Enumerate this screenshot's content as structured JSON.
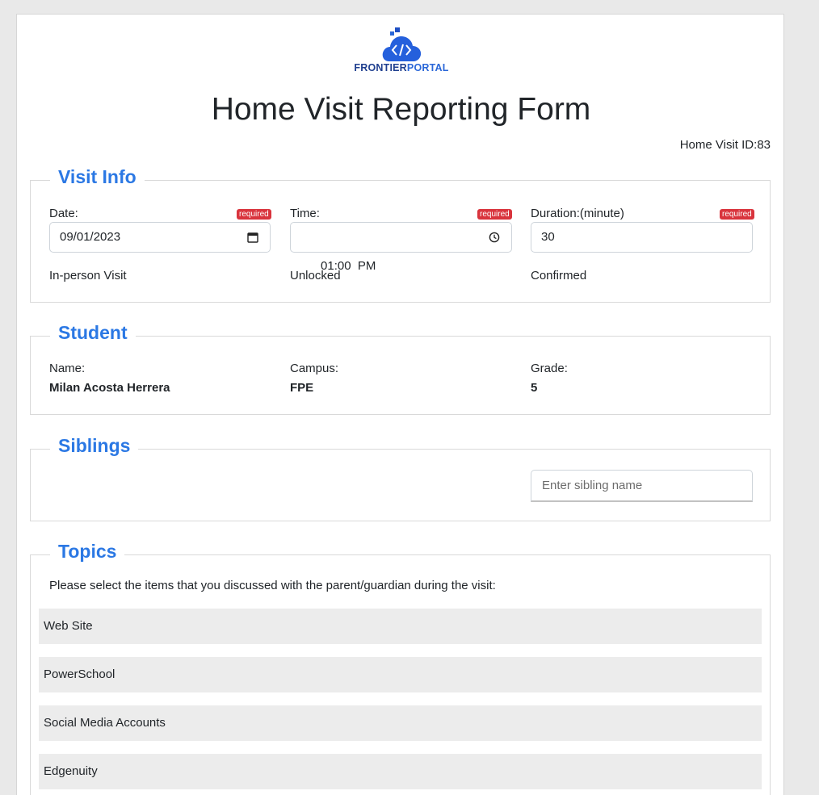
{
  "brand": {
    "part1": "FRONTIER",
    "part2": "PORTAL"
  },
  "form": {
    "title": "Home Visit Reporting Form",
    "visit_id_label": "Home Visit ID:",
    "visit_id_value": "83"
  },
  "visit_info": {
    "legend": "Visit Info",
    "date_label": "Date:",
    "date_value": "09/01/2023",
    "time_label": "Time:",
    "time_value": "01:00  PM",
    "duration_label": "Duration:(minute)",
    "duration_value": "30",
    "required_badge": "required",
    "visit_type": "In-person Visit",
    "lock_status": "Unlocked",
    "confirm_status": "Confirmed"
  },
  "student": {
    "legend": "Student",
    "name_label": "Name:",
    "name_value": "Milan Acosta Herrera",
    "campus_label": "Campus:",
    "campus_value": "FPE",
    "grade_label": "Grade:",
    "grade_value": "5"
  },
  "siblings": {
    "legend": "Siblings",
    "placeholder": "Enter sibling name"
  },
  "topics": {
    "legend": "Topics",
    "prompt": "Please select the items that you discussed with the parent/guardian during the visit:",
    "items": [
      "Web Site",
      "PowerSchool",
      "Social Media Accounts",
      "Edgenuity"
    ]
  },
  "colors": {
    "accent": "#2b78e4",
    "required": "#d9343d",
    "topic_bg": "#ececec"
  },
  "icons": {
    "logo": "cloud-code-icon",
    "date": "calendar-icon",
    "time": "clock-icon"
  }
}
